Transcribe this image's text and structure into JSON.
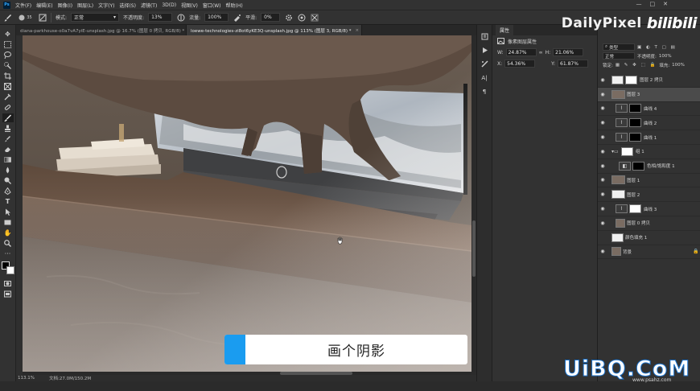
{
  "menu": {
    "logo": "Ps",
    "items": [
      "文件(F)",
      "编辑(E)",
      "图像(I)",
      "图层(L)",
      "文字(Y)",
      "选择(S)",
      "滤镜(T)",
      "3D(D)",
      "视图(V)",
      "窗口(W)",
      "帮助(H)"
    ],
    "controls": [
      "—",
      "□",
      "✕"
    ]
  },
  "options": {
    "brush_size": "35",
    "mode_label": "模式:",
    "mode_value": "正常",
    "opacity_label": "不透明度:",
    "opacity_value": "13%",
    "flow_label": "流量:",
    "flow_value": "100%",
    "smooth_label": "平滑:",
    "smooth_value": "0%"
  },
  "brand": {
    "site": "DailyPixel",
    "platform": "bilibili"
  },
  "tabs": [
    {
      "label": "diana-parkhouse-o0a7vA7yiE-unsplash.jpg @ 16.7% (图层 0 拷贝, RGB/8) *",
      "close": "×"
    },
    {
      "label": "loewe-technologies-zi8ot6yKE3Q-unsplash.jpg @ 113% (图层 3, RGB/8) *",
      "close": "×"
    }
  ],
  "status": {
    "zoom": "113.1%",
    "doc": "文档:27.0M/150.2M"
  },
  "caption": {
    "text": "画个阴影"
  },
  "properties": {
    "title": "属性",
    "subtitle": "像素图层属性",
    "w_label": "W:",
    "w_value": "24.87%",
    "h_label": "H:",
    "h_value": "21.06%",
    "x_label": "X:",
    "x_value": "54.36%",
    "y_label": "Y:",
    "y_value": "61.87%",
    "link_icon": "∞"
  },
  "layers_panel": {
    "filter_label": "类型",
    "blend_mode": "正常",
    "opacity_label": "不透明度:",
    "opacity_value": "100%",
    "lock_label": "锁定:",
    "fill_label": "填充:",
    "fill_value": "100%",
    "items": [
      {
        "name": "图层 2 拷贝"
      },
      {
        "name": "图层 3"
      },
      {
        "name": "曲线 4"
      },
      {
        "name": "曲线 2"
      },
      {
        "name": "曲线 1"
      },
      {
        "name": "组 1"
      },
      {
        "name": "色相/饱和度 1"
      },
      {
        "name": "图层 1"
      },
      {
        "name": "图层 2"
      },
      {
        "name": "曲线 3"
      },
      {
        "name": "图层 0 拷贝"
      },
      {
        "name": "颜色填充 1"
      },
      {
        "name": "背景"
      }
    ]
  },
  "watermark": {
    "big": "UiBQ.CoM",
    "small": "www.psahz.com"
  }
}
